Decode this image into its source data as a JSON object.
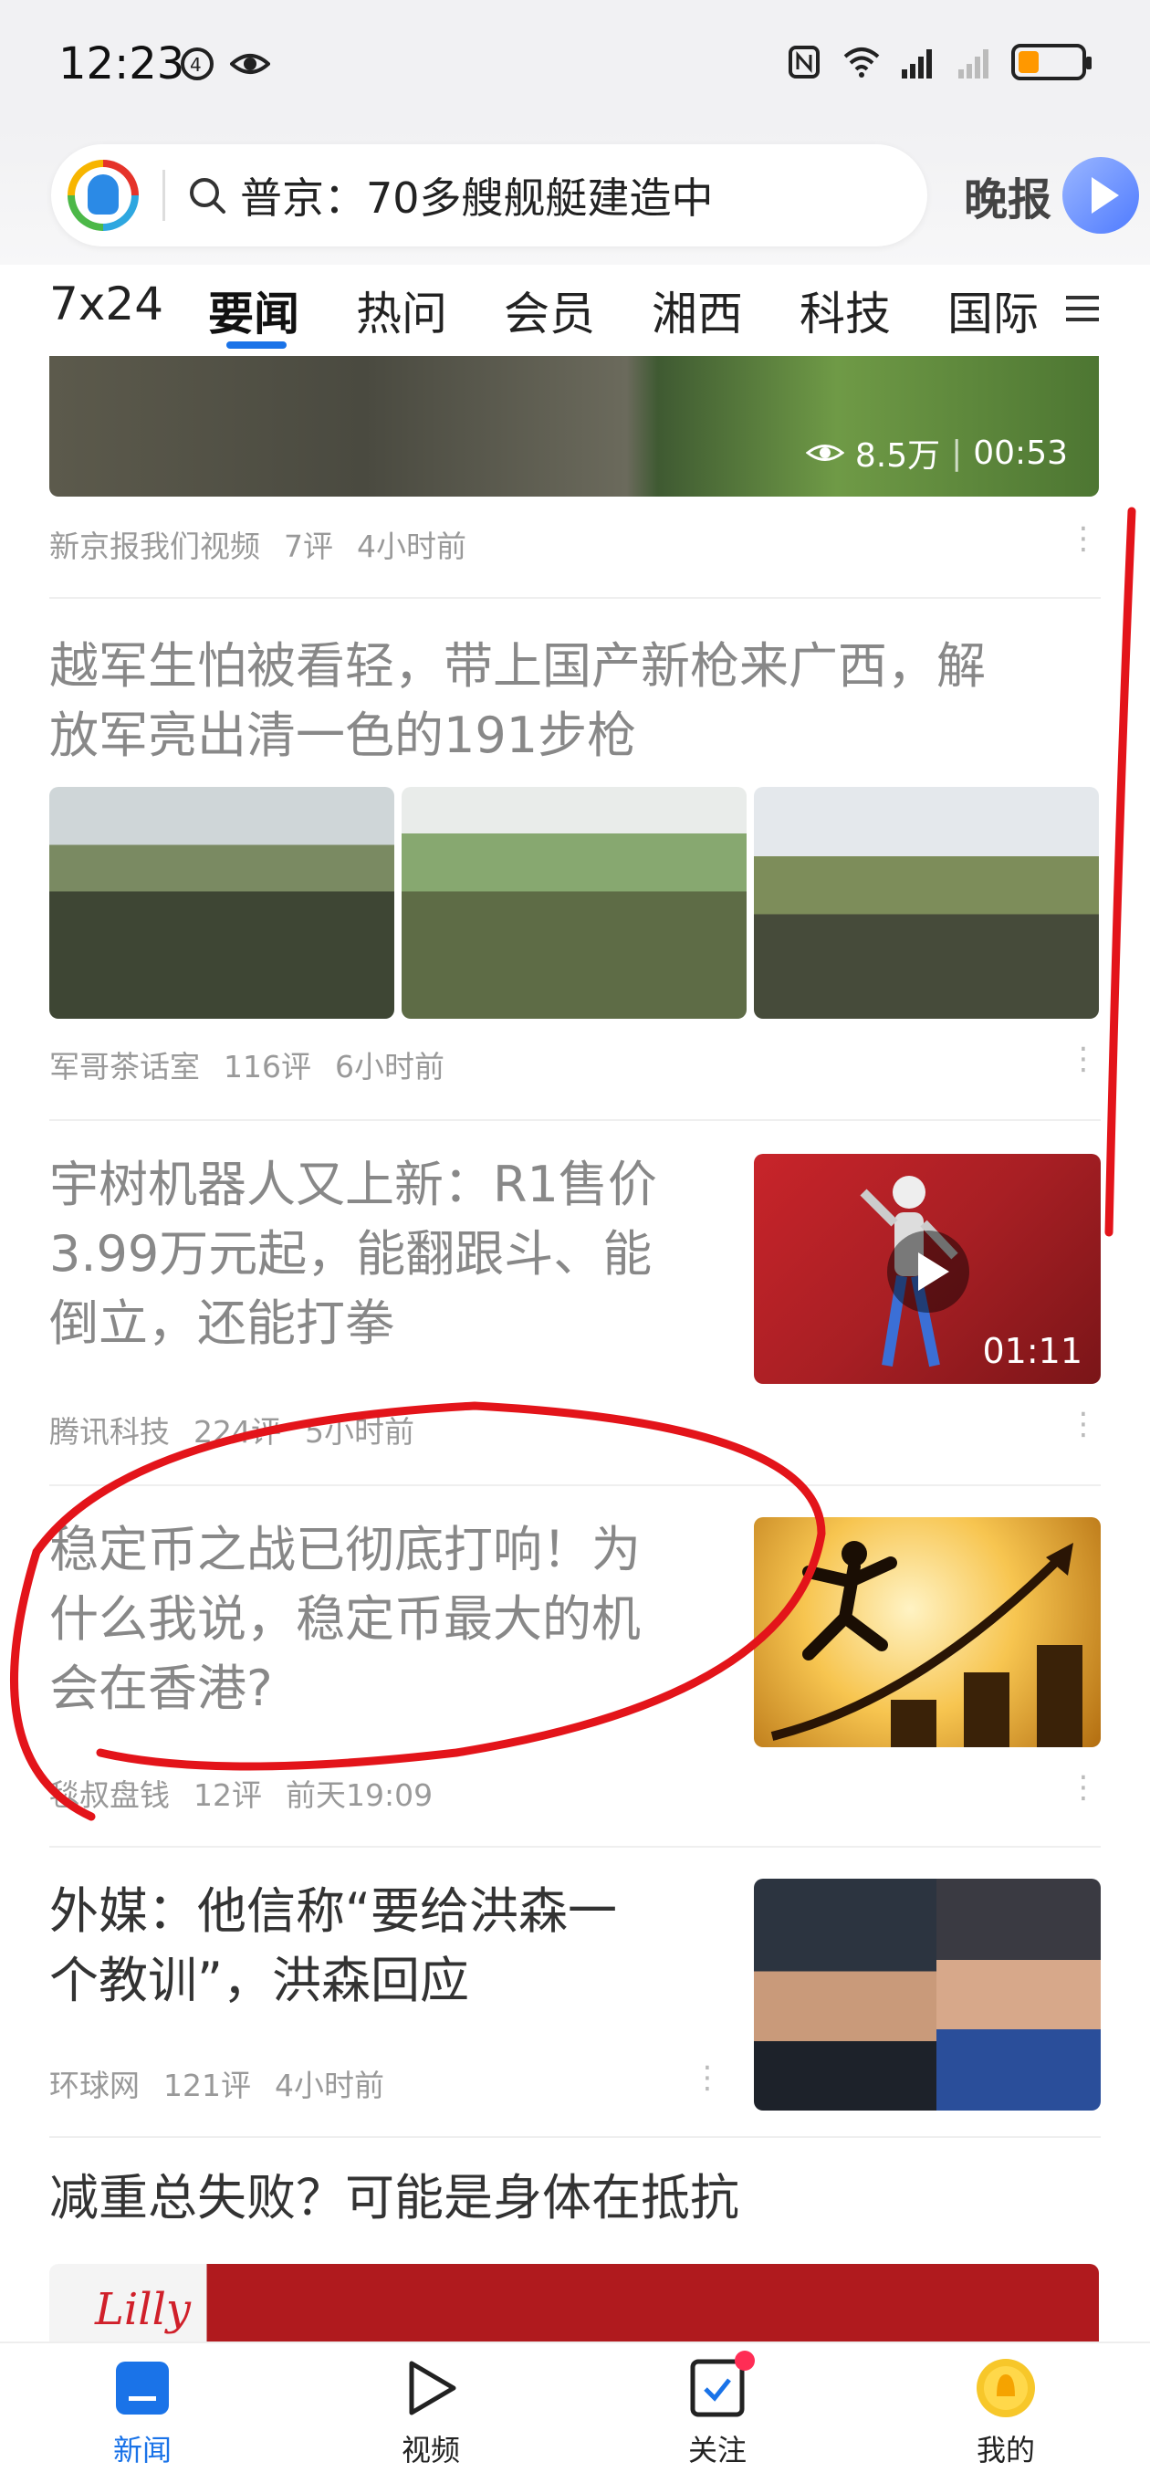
{
  "status_bar": {
    "time": "12:23"
  },
  "search": {
    "query": "普京：70多艘舰艇建造中",
    "evening_label": "晚报"
  },
  "tabs": [
    "7x24",
    "要闻",
    "热问",
    "会员",
    "湘西",
    "科技",
    "国际"
  ],
  "active_tab_index": 1,
  "feed": {
    "item0": {
      "views": "8.5万",
      "duration": "00:53",
      "source": "新京报我们视频",
      "comments": "7评",
      "time": "4小时前"
    },
    "item1": {
      "title_line1": "越军生怕被看轻，带上国产新枪来广西，解",
      "title_line2": "放军亮出清一色的191步枪",
      "source": "军哥茶话室",
      "comments": "116评",
      "time": "6小时前"
    },
    "item2": {
      "title_line1": "宇树机器人又上新：R1售价",
      "title_line2": "3.99万元起，能翻跟斗、能",
      "title_line3": "倒立，还能打拳",
      "duration": "01:11",
      "source": "腾讯科技",
      "comments": "224评",
      "time": "5小时前"
    },
    "item3": {
      "title_line1": "稳定币之战已彻底打响！为",
      "title_line2": "什么我说，稳定币最大的机",
      "title_line3": "会在香港?",
      "source": "毯叔盘钱",
      "comments": "12评",
      "time": "前天19:09"
    },
    "item4": {
      "title_line1": "外媒：他信称“要给洪森一",
      "title_line2": "个教训”，洪森回应",
      "source": "环球网",
      "comments": "121评",
      "time": "4小时前"
    },
    "item5": {
      "title": "减重总失败？可能是身体在抵抗",
      "logo_text": "Lilly"
    }
  },
  "bottom_nav": [
    {
      "label": "新闻",
      "icon": "news-icon"
    },
    {
      "label": "视频",
      "icon": "video-icon"
    },
    {
      "label": "关注",
      "icon": "follow-icon"
    },
    {
      "label": "我的",
      "icon": "profile-icon"
    }
  ],
  "colors": {
    "accent": "#1a73e8",
    "annotation": "#e3141a",
    "badge": "#ff2d55"
  }
}
